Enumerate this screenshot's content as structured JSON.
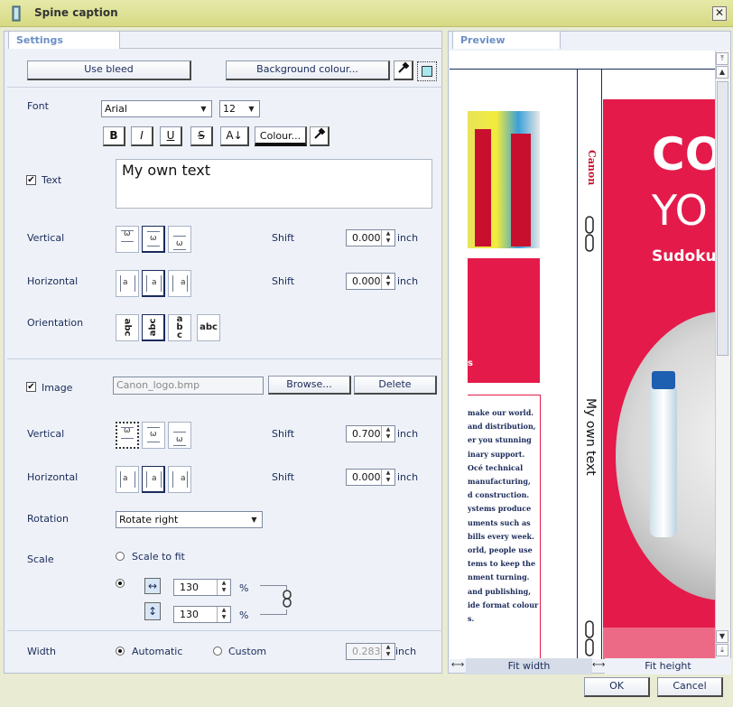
{
  "window": {
    "title": "Spine caption",
    "close_glyph": "✕"
  },
  "tabs": {
    "settings": "Settings",
    "preview": "Preview"
  },
  "top_buttons": {
    "use_bleed": "Use bleed",
    "background_colour": "Background colour..."
  },
  "font": {
    "label": "Font",
    "family": "Arial",
    "size": "12",
    "bold": "B",
    "italic": "I",
    "underline": "U",
    "strike": "S",
    "size_toggle": "A↓",
    "colour": "Colour..."
  },
  "text": {
    "checkbox_label": "Text",
    "checked": true,
    "value": "My own text"
  },
  "text_vertical": {
    "label": "Vertical",
    "shift_label": "Shift",
    "shift": "0.000",
    "unit": "inch"
  },
  "text_horizontal": {
    "label": "Horizontal",
    "shift_label": "Shift",
    "shift": "0.000",
    "unit": "inch"
  },
  "orientation": {
    "label": "Orientation",
    "glyph": "abc"
  },
  "image": {
    "checkbox_label": "Image",
    "checked": true,
    "file": "Canon_logo.bmp",
    "browse": "Browse...",
    "delete": "Delete"
  },
  "image_vertical": {
    "label": "Vertical",
    "shift_label": "Shift",
    "shift": "0.700",
    "unit": "inch"
  },
  "image_horizontal": {
    "label": "Horizontal",
    "shift_label": "Shift",
    "shift": "0.000",
    "unit": "inch"
  },
  "rotation": {
    "label": "Rotation",
    "value": "Rotate right"
  },
  "scale": {
    "label": "Scale",
    "fit_label": "Scale to fit",
    "width": "130",
    "height": "130",
    "unit": "%"
  },
  "width": {
    "label": "Width",
    "automatic": "Automatic",
    "custom": "Custom",
    "value": "0.283",
    "unit": "inch"
  },
  "preview": {
    "brand": "Canon",
    "spine_text": "My own text",
    "cover_line1": "CO",
    "cover_line2": "YO",
    "cover_line3": "Sudoku",
    "fit_width": "Fit width",
    "fit_height": "Fit height",
    "body_text": [
      "make our world.",
      "and distribution,",
      "er you stunning",
      "inary support.",
      "Océ technical",
      "manufacturing,",
      "d construction.",
      "ystems produce",
      "uments such as",
      "bills every week.",
      "orld, people use",
      "tems to keep the",
      "nment turning.",
      "and publishing,",
      "ide format colour",
      "s."
    ],
    "red_text": "s"
  },
  "footer": {
    "ok": "OK",
    "cancel": "Cancel"
  },
  "colors": {
    "accent_red": "#e41b4a",
    "tab_text": "#6b8fc5",
    "titlebar": "#dfe29a"
  }
}
